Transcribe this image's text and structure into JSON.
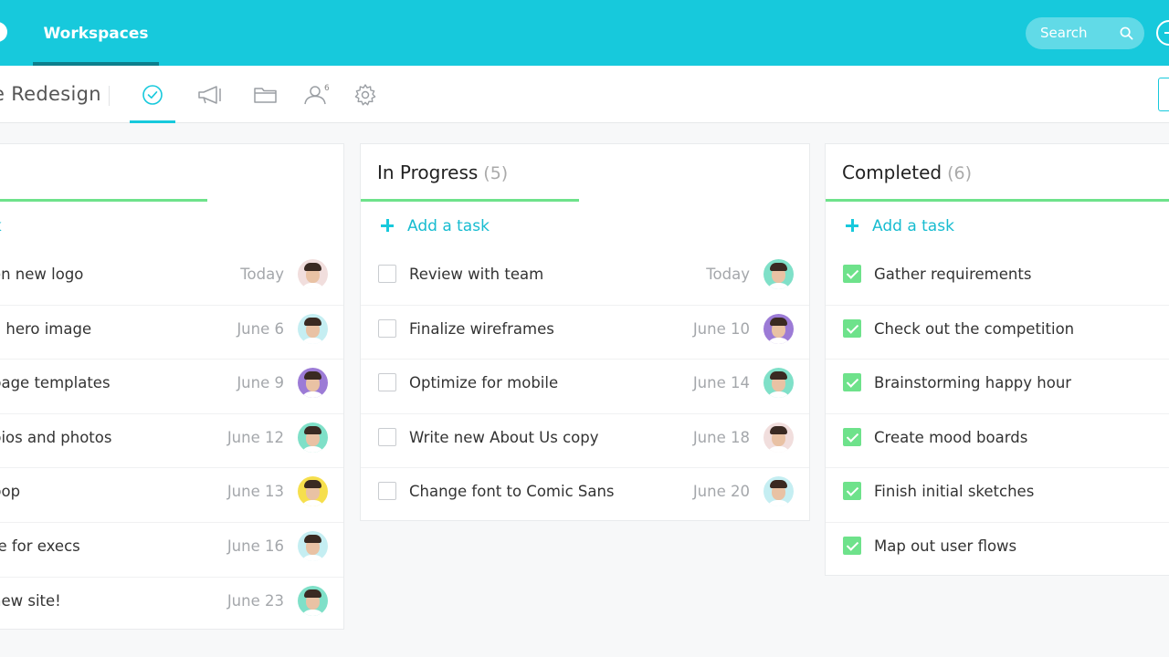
{
  "topbar": {
    "nav_tab": "Workspaces",
    "search_label": "Search",
    "accent_color": "#17c9dc"
  },
  "subbar": {
    "project_title": "e Redesign",
    "members_count": "6",
    "tools": [
      "tasks-icon",
      "announcements-icon",
      "files-icon",
      "members-icon",
      "settings-icon"
    ]
  },
  "columns": {
    "todo": {
      "add_label": "sk",
      "tasks": [
        {
          "name": "on new logo",
          "due": "Today",
          "avatar_bg": "#f1dedd"
        },
        {
          "name": "a hero image",
          "due": "June 6",
          "avatar_bg": "#c5eef2"
        },
        {
          "name": "page templates",
          "due": "June 9",
          "avatar_bg": "#9c7bd6"
        },
        {
          "name": "bios and photos",
          "due": "June 12",
          "avatar_bg": "#7fe0c8"
        },
        {
          "name": "pop",
          "due": "June 13",
          "avatar_bg": "#f6df4d"
        },
        {
          "name": "te for execs",
          "due": "June 16",
          "avatar_bg": "#c5eef2"
        },
        {
          "name": "new site!",
          "due": "June 23",
          "avatar_bg": "#7fe0c8"
        }
      ]
    },
    "progress": {
      "title": "In Progress",
      "count": "(5)",
      "add_label": "Add a task",
      "tasks": [
        {
          "name": "Review with team",
          "due": "Today",
          "avatar_bg": "#7fe0c8"
        },
        {
          "name": "Finalize wireframes",
          "due": "June 10",
          "avatar_bg": "#9c7bd6"
        },
        {
          "name": "Optimize for mobile",
          "due": "June 14",
          "avatar_bg": "#7fe0c8"
        },
        {
          "name": "Write new About Us copy",
          "due": "June 18",
          "avatar_bg": "#f1dedd"
        },
        {
          "name": "Change font to Comic Sans",
          "due": "June 20",
          "avatar_bg": "#c5eef2"
        }
      ]
    },
    "done": {
      "title": "Completed",
      "count": "(6)",
      "add_label": "Add a task",
      "tasks": [
        {
          "name": "Gather requirements"
        },
        {
          "name": "Check out the competition"
        },
        {
          "name": "Brainstorming happy hour"
        },
        {
          "name": "Create mood boards"
        },
        {
          "name": "Finish initial sketches"
        },
        {
          "name": "Map out user flows"
        }
      ]
    }
  }
}
